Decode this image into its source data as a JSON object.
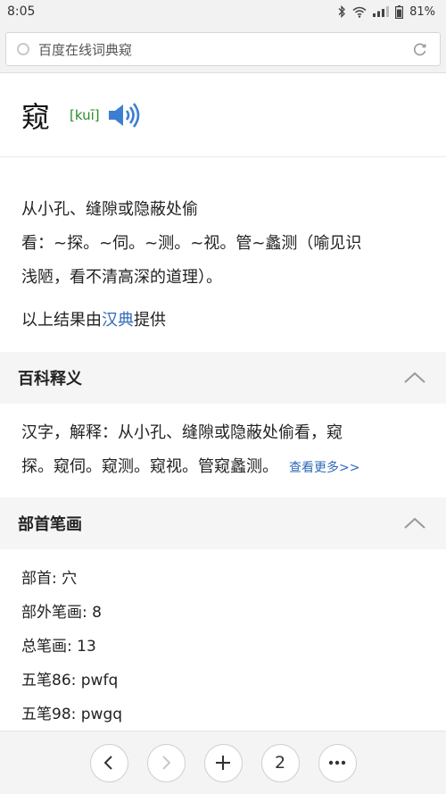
{
  "status": {
    "time": "8:05",
    "battery": "81%"
  },
  "browser": {
    "url": "百度在线词典窥"
  },
  "word": {
    "char": "窥",
    "pinyin": "[kuī]"
  },
  "definition": {
    "line1": "从小孔、缝隙或隐蔽处偷",
    "line2": "看：~探。~伺。~测。~视。管~蠡测（喻见识",
    "line3": "浅陋，看不清高深的道理）。",
    "source_prefix": "以上结果由",
    "source_link": "汉典",
    "source_suffix": "提供"
  },
  "baike": {
    "header": "百科释义",
    "line1": "汉字，解释：从小孔、缝隙或隐蔽处偷看，窥",
    "line2": "探。窥伺。窥测。窥视。管窥蠡测。",
    "more": "查看更多>>"
  },
  "bushou": {
    "header": "部首笔画",
    "items": [
      "部首: 穴",
      "部外笔画: 8",
      "总笔画: 13",
      "五笔86: pwfq",
      "五笔98: pwgq"
    ]
  },
  "nav": {
    "tabs_count": "2"
  }
}
